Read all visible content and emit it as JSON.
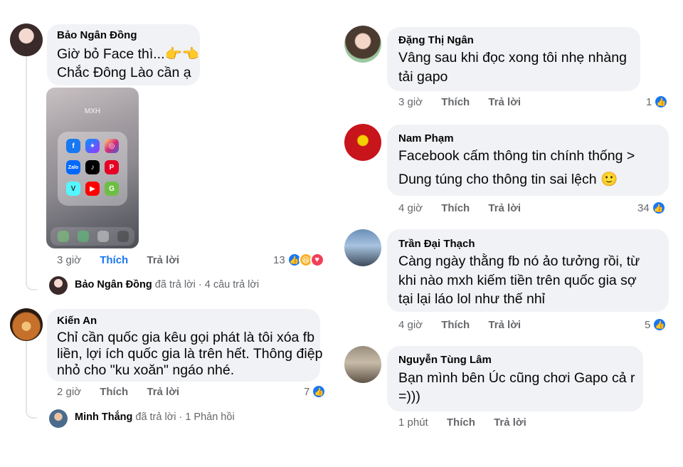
{
  "left_column": {
    "comment1": {
      "author": "Bảo Ngân Đồng",
      "text_lines": [
        "Giờ bỏ Face thì...👉👈",
        "Chắc Đông Lào cần ạ"
      ],
      "phone": {
        "folder_label": "MXH",
        "apps": [
          "facebook-icon",
          "messenger-icon",
          "instagram-icon",
          "zalo-icon",
          "tiktok-icon",
          "pinterest-icon",
          "vlive-icon",
          "youtube-icon",
          "gapo-icon"
        ],
        "zalo_label": "Zalo"
      },
      "time": "3 giờ",
      "like_label": "Thích",
      "reply_label": "Trả lời",
      "reaction_count": "13",
      "replies": {
        "author": "Bảo Ngân Đồng",
        "action": "đã trả lời",
        "count": "· 4 câu trả lời"
      }
    },
    "comment2": {
      "author": "Kiến An",
      "text_lines": [
        "Chỉ cần quốc gia kêu gọi phát là tôi xóa fb",
        "liền, lợi ích quốc gia là trên hết. Thông điệp",
        "nhỏ cho \"ku xoăn\" ngáo nhé."
      ],
      "time": "2 giờ",
      "like_label": "Thích",
      "reply_label": "Trả lời",
      "reaction_count": "7",
      "replies": {
        "author": "Minh Thắng",
        "action": "đã trả lời",
        "count": "· 1 Phản hồi"
      }
    }
  },
  "right_column": {
    "comment1": {
      "author": "Đặng Thị Ngân",
      "text_lines": [
        "Vâng sau khi đọc xong tôi nhẹ nhàng",
        "tải gapo"
      ],
      "time": "3 giờ",
      "like_label": "Thích",
      "reply_label": "Trả lời",
      "reaction_count": "1"
    },
    "comment2": {
      "author": "Nam Phạm",
      "text_lines": [
        "Facebook cấm thông tin chính thống >",
        "Dung túng cho thông tin sai lệch 🙂"
      ],
      "time": "4 giờ",
      "like_label": "Thích",
      "reply_label": "Trả lời",
      "reaction_count": "34"
    },
    "comment3": {
      "author": "Trần Đại Thạch",
      "text_lines": [
        "Càng ngày thằng fb nó ảo tưởng rồi, từ",
        "khi nào mxh kiếm tiền trên quốc gia sợ",
        "tại lại láo lol như thế nhỉ"
      ],
      "time": "4 giờ",
      "like_label": "Thích",
      "reply_label": "Trả lời",
      "reaction_count": "5"
    },
    "comment4": {
      "author": "Nguyễn Tùng Lâm",
      "text_lines": [
        "Bạn mình bên Úc cũng chơi Gapo cả r",
        "=)))"
      ],
      "time": "1 phút",
      "like_label": "Thích",
      "reply_label": "Trả lời"
    }
  },
  "colors": {
    "bubble": "#f0f2f5",
    "meta_text": "#65676b",
    "accent_blue": "#1877f2"
  }
}
